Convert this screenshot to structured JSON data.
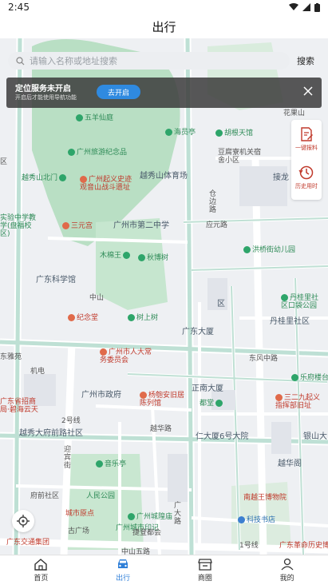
{
  "status_bar": {
    "time": "2:45"
  },
  "header": {
    "title": "出行"
  },
  "search": {
    "placeholder": "请输入名称或地址搜索",
    "button_label": "搜索"
  },
  "location_banner": {
    "title": "定位服务未开启",
    "subtitle": "开启后才能使用导航功能",
    "enable_label": "去开启"
  },
  "side_panel": {
    "items": [
      {
        "label": "一键报料",
        "icon": "edit-doc-icon"
      },
      {
        "label": "历史用时",
        "icon": "clock-history-icon"
      }
    ]
  },
  "map": {
    "pois": [
      {
        "label": "五羊仙庭",
        "color": "green"
      },
      {
        "label": "海员亭",
        "color": "green"
      },
      {
        "label": "胡根天馆",
        "color": "green"
      },
      {
        "label": "广州旅游纪念品",
        "color": "green"
      },
      {
        "label": "豆腐寮机关宿舍小区",
        "color": "gray"
      },
      {
        "label": "越秀山体育场",
        "color": "gray"
      },
      {
        "label": "越秀山北门",
        "color": "green"
      },
      {
        "label": "广州起义史迹观音山战斗遗址",
        "color": "red"
      },
      {
        "label": "接龙",
        "color": "gray"
      },
      {
        "label": "实验中学教学(盘福校区)",
        "color": "green"
      },
      {
        "label": "三元宫",
        "color": "red"
      },
      {
        "label": "广州市第二中学",
        "color": "gray"
      },
      {
        "label": "应元路",
        "color": "gray"
      },
      {
        "label": "洪桥街幼儿园",
        "color": "green"
      },
      {
        "label": "木棉王",
        "color": "green"
      },
      {
        "label": "秋博树",
        "color": "green"
      },
      {
        "label": "广东科学馆",
        "color": "gray"
      },
      {
        "label": "中山",
        "color": "gray"
      },
      {
        "label": "纪念堂",
        "color": "red"
      },
      {
        "label": "树上树",
        "color": "green"
      },
      {
        "label": "丹桂里社区口袋公园",
        "color": "green"
      },
      {
        "label": "丹桂里社区",
        "color": "gray"
      },
      {
        "label": "广东大厦",
        "color": "gray"
      },
      {
        "label": "区",
        "color": "gray"
      },
      {
        "label": "广州市人大常务委员会",
        "color": "red"
      },
      {
        "label": "东风中路",
        "color": "gray"
      },
      {
        "label": "乐府楼台",
        "color": "green"
      },
      {
        "label": "东雅苑",
        "color": "gray"
      },
      {
        "label": "机电",
        "color": "gray"
      },
      {
        "label": "正南大厦",
        "color": "gray"
      },
      {
        "label": "广州市政府",
        "color": "gray"
      },
      {
        "label": "杨匏安旧居陈列馆",
        "color": "red"
      },
      {
        "label": "三二九起义指挥部旧址",
        "color": "red"
      },
      {
        "label": "广东省招商局·碧海云天",
        "color": "red"
      },
      {
        "label": "都堂",
        "color": "green"
      },
      {
        "label": "2号线",
        "color": "gray"
      },
      {
        "label": "越秀大府前路社区",
        "color": "gray"
      },
      {
        "label": "越华路",
        "color": "gray"
      },
      {
        "label": "仁大厦6号大院",
        "color": "gray"
      },
      {
        "label": "银山大",
        "color": "gray"
      },
      {
        "label": "迎宾街",
        "color": "gray"
      },
      {
        "label": "音乐亭",
        "color": "green"
      },
      {
        "label": "越华阁",
        "color": "gray"
      },
      {
        "label": "府前社区",
        "color": "gray"
      },
      {
        "label": "人民公园",
        "color": "green"
      },
      {
        "label": "广州城隍庙",
        "color": "green"
      },
      {
        "label": "南越王博物院",
        "color": "red"
      },
      {
        "label": "城市原点",
        "color": "red"
      },
      {
        "label": "广州城市印记",
        "color": "green"
      },
      {
        "label": "科技书店",
        "color": "blue"
      },
      {
        "label": "古广场",
        "color": "gray"
      },
      {
        "label": "捷登都会",
        "color": "gray"
      },
      {
        "label": "广东交通集团",
        "color": "red"
      },
      {
        "label": "中山五路",
        "color": "gray"
      },
      {
        "label": "广东革命历史博物馆",
        "color": "red"
      },
      {
        "label": "花果山",
        "color": "gray"
      },
      {
        "label": "1号线",
        "color": "gray"
      },
      {
        "label": "广大路",
        "color": "gray"
      },
      {
        "label": "仓边路",
        "color": "gray"
      },
      {
        "label": "区",
        "color": "gray"
      }
    ]
  },
  "bottom_nav": {
    "items": [
      {
        "label": "首页",
        "icon": "home-icon",
        "active": false
      },
      {
        "label": "出行",
        "icon": "car-icon",
        "active": true
      },
      {
        "label": "商圈",
        "icon": "store-icon",
        "active": false
      },
      {
        "label": "我的",
        "icon": "user-icon",
        "active": false
      }
    ]
  },
  "colors": {
    "accent": "#2f7fd8",
    "banner_button": "#2f8ae0",
    "side_text": "#c0392b"
  }
}
